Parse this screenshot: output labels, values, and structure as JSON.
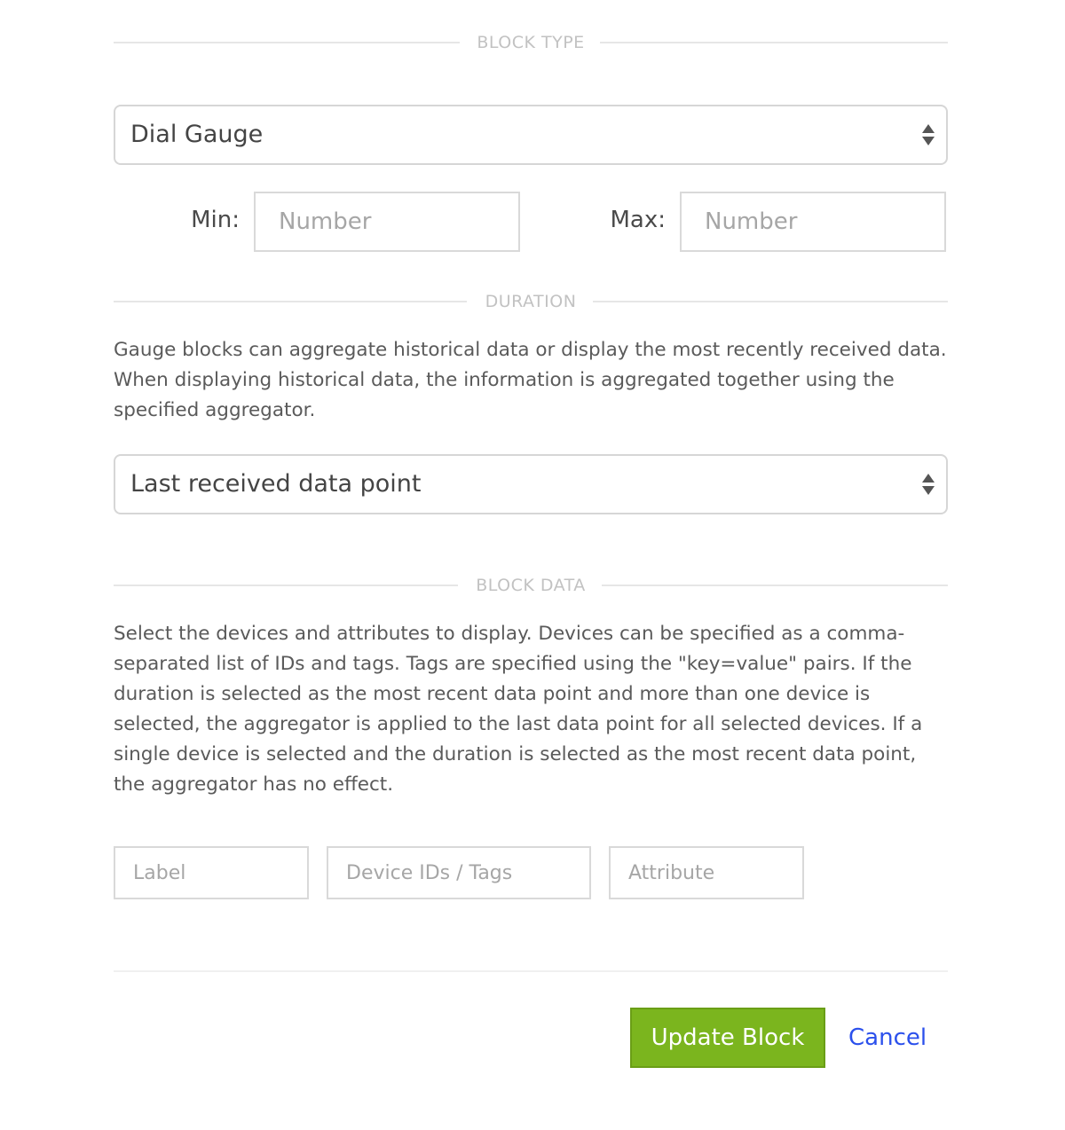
{
  "sections": {
    "block_type": "BLOCK TYPE",
    "duration": "DURATION",
    "block_data": "BLOCK DATA"
  },
  "block_type_select": {
    "value": "Dial Gauge"
  },
  "range": {
    "min_label": "Min:",
    "min_placeholder": "Number",
    "max_label": "Max:",
    "max_placeholder": "Number"
  },
  "duration_description": "Gauge blocks can aggregate historical data or display the most recently received data. When displaying historical data, the information is aggregated together using the specified aggregator.",
  "duration_select": {
    "value": "Last received data point"
  },
  "block_data_description": "Select the devices and attributes to display. Devices can be specified as a comma-separated list of IDs and tags. Tags are specified using the \"key=value\" pairs. If the duration is selected as the most recent data point and more than one device is selected, the aggregator is applied to the last data point for all selected devices. If a single device is selected and the duration is selected as the most recent data point, the aggregator has no effect.",
  "data_row": {
    "label_placeholder": "Label",
    "device_placeholder": "Device IDs / Tags",
    "attribute_placeholder": "Attribute"
  },
  "actions": {
    "update_label": "Update Block",
    "cancel_label": "Cancel"
  }
}
